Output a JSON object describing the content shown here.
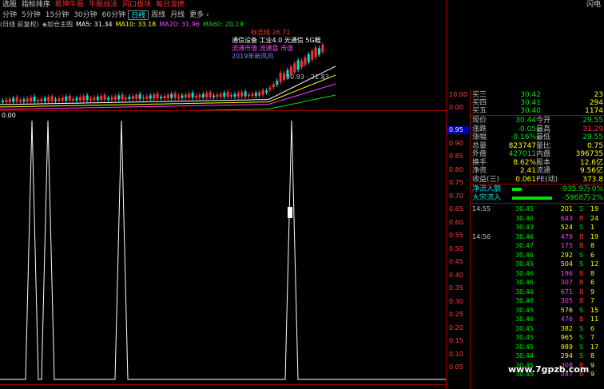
{
  "menu": {
    "items": [
      "选股",
      "指标排序",
      "乾坤牛股",
      "牛股战法",
      "风口板块",
      "每日龙虎"
    ],
    "right": "闪电"
  },
  "periods": [
    "分钟",
    "5分钟",
    "15分钟",
    "30分钟",
    "60分钟",
    "日线",
    "周线",
    "月线",
    "更多 ›"
  ],
  "periods_active": "日线",
  "ma_bar": {
    "mode": "(日线 前复权)",
    "add": "◈加仓主图",
    "ma5": "MA5: 31.34",
    "ma10": "MA10: 33.18",
    "ma20": "MA20: 31.96",
    "ma60": "MA60: 20.19"
  },
  "upper_legend": {
    "line1": "标志线 26.71",
    "line2": "通信设备 工业4.0 光通信 5G概",
    "line3": "流通市值 流通盘 市值",
    "line4": "2019年新风向",
    "price_label": "30.93 - 21.83"
  },
  "lower_label": "0.00",
  "axis": {
    "upper_ticks": [
      "10.00",
      "0.00"
    ],
    "lower_ticks": [
      "0.95",
      "0.90",
      "0.85",
      "0.80",
      "0.75",
      "0.70",
      "0.65",
      "0.60",
      "0.55",
      "0.50",
      "0.45",
      "0.40",
      "0.35",
      "0.30",
      "0.25",
      "0.20",
      "0.15",
      "0.10",
      "0.05"
    ],
    "highlight": "0.95"
  },
  "panel": {
    "asks": [
      {
        "label": "买三",
        "price": "30.42",
        "vol": "23"
      },
      {
        "label": "买四",
        "price": "30.41",
        "vol": "294"
      },
      {
        "label": "买五",
        "price": "30.40",
        "vol": "1174"
      }
    ],
    "stats": [
      {
        "l1": "现价",
        "v1": "30.44",
        "l2": "今开",
        "v2": "29.55"
      },
      {
        "l1": "涨跌",
        "v1": "-0.05",
        "l2": "最高",
        "v2": "31.29"
      },
      {
        "l1": "涨幅",
        "v1": "-0.16%",
        "l2": "最低",
        "v2": "29.55"
      },
      {
        "l1": "总量",
        "v1": "823747",
        "l2": "量比",
        "v2": "0.75"
      },
      {
        "l1": "外盘",
        "v1": "427011",
        "l2": "内盘",
        "v2": "396735"
      },
      {
        "l1": "换手",
        "v1": "8.62%",
        "l2": "股本",
        "v2": "12.6亿"
      },
      {
        "l1": "净资",
        "v1": "2.41",
        "l2": "流通",
        "v2": "9.56亿"
      },
      {
        "l1": "收益(三)",
        "v1": "0.061",
        "l2": "PE(动)",
        "v2": "373.8"
      }
    ],
    "flows": [
      {
        "label": "净流入额",
        "value": "-935.9万",
        "pct": "-0%"
      },
      {
        "label": "大宗流入",
        "value": "-5968万",
        "pct": "-2%"
      }
    ],
    "ticks": [
      {
        "time": "14:55",
        "price": "30.45",
        "vol": "201",
        "bs": "S",
        "vv": "19"
      },
      {
        "time": "",
        "price": "30.46",
        "vol": "643",
        "bs": "B",
        "vv": "24"
      },
      {
        "time": "",
        "price": "30.43",
        "vol": "524",
        "bs": "S",
        "vv": "1"
      },
      {
        "time": "14:56",
        "price": "30.46",
        "vol": "479",
        "bs": "B",
        "vv": "19"
      },
      {
        "time": "",
        "price": "30.47",
        "vol": "175",
        "bs": "B",
        "vv": "8"
      },
      {
        "time": "",
        "price": "30.46",
        "vol": "292",
        "bs": "S",
        "vv": "6"
      },
      {
        "time": "",
        "price": "30.45",
        "vol": "504",
        "bs": "S",
        "vv": "12"
      },
      {
        "time": "",
        "price": "30.46",
        "vol": "196",
        "bs": "B",
        "vv": "8"
      },
      {
        "time": "",
        "price": "30.46",
        "vol": "307",
        "bs": "B",
        "vv": "6"
      },
      {
        "time": "",
        "price": "30.46",
        "vol": "671",
        "bs": "B",
        "vv": "9"
      },
      {
        "time": "",
        "price": "30.46",
        "vol": "305",
        "bs": "B",
        "vv": "7"
      },
      {
        "time": "",
        "price": "30.45",
        "vol": "576",
        "bs": "S",
        "vv": "15"
      },
      {
        "time": "",
        "price": "30.46",
        "vol": "476",
        "bs": "B",
        "vv": "11"
      },
      {
        "time": "",
        "price": "30.45",
        "vol": "382",
        "bs": "S",
        "vv": "6"
      },
      {
        "time": "",
        "price": "30.45",
        "vol": "965",
        "bs": "S",
        "vv": "7"
      },
      {
        "time": "",
        "price": "30.45",
        "vol": "989",
        "bs": "S",
        "vv": "17"
      },
      {
        "time": "",
        "price": "30.44",
        "vol": "294",
        "bs": "S",
        "vv": "8"
      },
      {
        "time": "",
        "price": "30.45",
        "vol": "308",
        "bs": "B",
        "vv": "9"
      },
      {
        "time": "",
        "price": "30.45",
        "vol": "487",
        "bs": "B",
        "vv": "9"
      }
    ]
  },
  "watermark": "www.7gpzb.com",
  "colors": {
    "red": "#ff3030",
    "green": "#00e000",
    "grid_red": "#a00000",
    "yellow": "#ffff00",
    "magenta": "#ff40ff",
    "white": "#ffffff"
  }
}
